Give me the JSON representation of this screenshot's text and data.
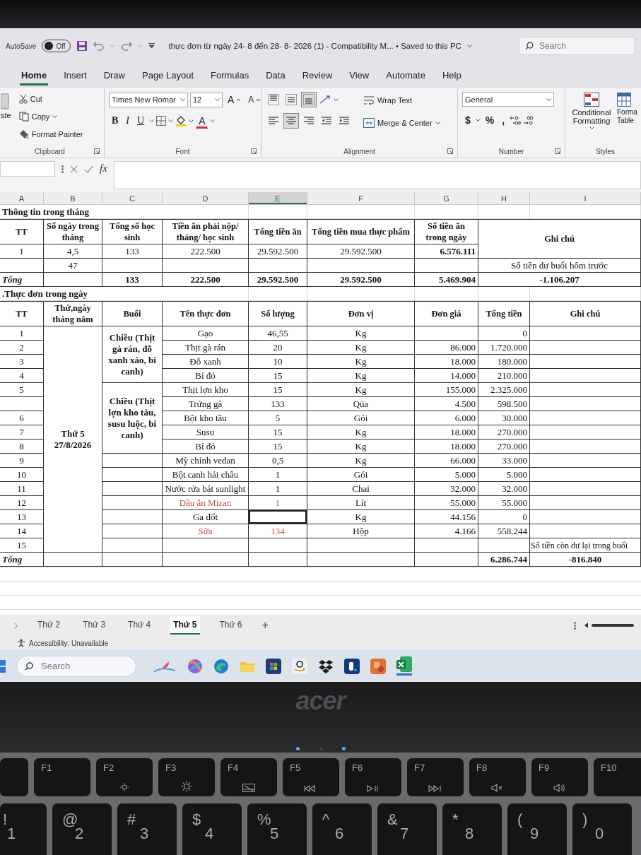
{
  "title_bar": {
    "autosave_label": "AutoSave",
    "autosave": {
      "on": false,
      "label": "Off"
    },
    "document_title": "thực đơn từ ngày 24- 8 đến 28- 8- 2026 (1) - Compatibility M... • Saved to this PC",
    "search": {
      "placeholder": "Search"
    }
  },
  "ribbon_tabs": [
    {
      "label": "Home",
      "selected": true
    },
    {
      "label": "Insert",
      "selected": false
    },
    {
      "label": "Draw",
      "selected": false
    },
    {
      "label": "Page Layout",
      "selected": false
    },
    {
      "label": "Formulas",
      "selected": false
    },
    {
      "label": "Data",
      "selected": false
    },
    {
      "label": "Review",
      "selected": false
    },
    {
      "label": "View",
      "selected": false
    },
    {
      "label": "Automate",
      "selected": false
    },
    {
      "label": "Help",
      "selected": false
    }
  ],
  "ribbon": {
    "clipboard": {
      "paste_label": "ste",
      "cut": "Cut",
      "copy": "Copy",
      "format_painter": "Format Painter",
      "group_label": "Clipboard"
    },
    "font": {
      "font_name": "Times New Romar",
      "font_size": "12",
      "grow_glyph": "A",
      "shrink_glyph": "A",
      "bold_glyph": "B",
      "italic_glyph": "I",
      "underline_glyph": "U",
      "font_color_glyph": "A",
      "group_label": "Font"
    },
    "alignment": {
      "buttons": [
        {
          "kind": "top",
          "selected": false
        },
        {
          "kind": "middle",
          "selected": false
        },
        {
          "kind": "bottom",
          "selected": true
        },
        {
          "kind": "left",
          "selected": false
        },
        {
          "kind": "center",
          "selected": true
        },
        {
          "kind": "right",
          "selected": false
        },
        {
          "kind": "indent-decrease",
          "selected": false
        },
        {
          "kind": "indent-increase",
          "selected": false
        }
      ],
      "wrap_text": "Wrap Text",
      "merge": "Merge & Center",
      "group_label": "Alignment"
    },
    "number": {
      "format": "General",
      "currency": "$",
      "percent": "%",
      "comma": ",",
      "group_label": "Number"
    },
    "styles": {
      "conditional": "Conditional Formatting",
      "format_table": "Forma Table",
      "group_label": "Styles"
    }
  },
  "formula_bar": {
    "fx": "fx"
  },
  "sheet": {
    "columns": [
      {
        "letter": "A",
        "selected": false
      },
      {
        "letter": "B",
        "selected": false
      },
      {
        "letter": "C",
        "selected": false
      },
      {
        "letter": "D",
        "selected": false
      },
      {
        "letter": "E",
        "selected": true
      },
      {
        "letter": "F",
        "selected": false
      },
      {
        "letter": "G",
        "selected": false
      },
      {
        "letter": "H",
        "selected": false
      },
      {
        "letter": "I",
        "selected": false
      }
    ],
    "info": {
      "title": "Thông tin trong tháng",
      "columns": [
        "TT",
        "Số ngày trong tháng",
        "Tổng số học sinh",
        "Tiền ăn phải nộp/ tháng/ học sinh",
        "Tổng tiền ăn",
        "Tổng tiền mua thực phẩm",
        "Số tiền ăn trong ngày",
        "Ghi chú"
      ],
      "rows": [
        {
          "kind": "data",
          "tt": "1",
          "days": "4,5",
          "students": "133",
          "fee": "222.500",
          "total_fee": "29.592.500",
          "food_total": "29.592.500",
          "daily": "6.576.111"
        },
        {
          "kind": "data",
          "days": "47",
          "note": "Số tiền dư buổi hôm trước"
        },
        {
          "kind": "total",
          "tt": "Tổng",
          "students": "133",
          "fee": "222.500",
          "total_fee": "29.592.500",
          "food_total": "29.592.500",
          "daily": "5.469.904",
          "note": "-1.106.207"
        }
      ]
    },
    "menu": {
      "title": ".Thực đơn trong ngày",
      "columns": [
        "TT",
        "Thứ,ngày tháng năm",
        "Buổi",
        "Tên thực đơn",
        "Số lượng",
        "Đơn vị",
        "Đơn giá",
        "Tổng tiền",
        "Ghi chú"
      ],
      "day": "Thứ 5 27/8/2026",
      "sessions": [
        {
          "label": "Chiều (Thịt gà rán, đỗ xanh xào, bí canh)",
          "items": [
            {
              "tt": "1",
              "name": "Gạo",
              "qty": "46,55",
              "unit": "Kg",
              "total": "0",
              "selected": false
            },
            {
              "tt": "2",
              "name": "Thịt gà rán",
              "qty": "20",
              "unit": "Kg",
              "price": "86.000",
              "total": "1.720.000",
              "selected": false
            },
            {
              "tt": "3",
              "name": "Đỗ xanh",
              "qty": "10",
              "unit": "Kg",
              "price": "18.000",
              "total": "180.000",
              "selected": false
            },
            {
              "tt": "4",
              "name": "Bí đỏ",
              "qty": "15",
              "unit": "Kg",
              "price": "14.000",
              "total": "210.000",
              "selected": false
            }
          ]
        },
        {
          "label": "Chiều (Thịt lợn kho tàu, susu luộc, bí canh)",
          "items": [
            {
              "tt": "5",
              "name": "Thịt lợn kho",
              "qty": "15",
              "unit": "Kg",
              "price": "155.000",
              "total": "2.325.000",
              "selected": false
            },
            {
              "name": "Trứng gà",
              "qty": "133",
              "unit": "Qủa",
              "price": "4.500",
              "total": "598.500",
              "selected": false
            },
            {
              "tt": "6",
              "name": "Bột kho tầu",
              "qty": "5",
              "unit": "Gói",
              "price": "6.000",
              "total": "30.000",
              "selected": false
            },
            {
              "tt": "7",
              "name": "Susu",
              "qty": "15",
              "unit": "Kg",
              "price": "18.000",
              "total": "270.000",
              "selected": false
            },
            {
              "tt": "8",
              "name": "Bí đỏ",
              "qty": "15",
              "unit": "Kg",
              "price": "18.000",
              "total": "270.000",
              "selected": false
            }
          ]
        },
        {
          "items": [
            {
              "tt": "9",
              "name": "Mỳ chính vedan",
              "qty": "0,5",
              "unit": "Kg",
              "price": "66.000",
              "total": "33.000",
              "selected": false
            },
            {
              "tt": "10",
              "name": "Bột canh hải châu",
              "qty": "1",
              "unit": "Gói",
              "price": "5.000",
              "total": "5.000",
              "selected": false
            },
            {
              "tt": "11",
              "name": "Nước rửa bát sunlight",
              "qty": "1",
              "unit": "Chai",
              "price": "32.000",
              "total": "32.000",
              "selected": false
            },
            {
              "tt": "12",
              "name": "Dầu ăn Mizan",
              "qty": "1",
              "unit": "Lít",
              "price": "55.000",
              "total": "55.000",
              "color": "#c0504d",
              "selected": false
            },
            {
              "tt": "13",
              "name": "Ga đốt",
              "unit": "Kg",
              "price": "44.156",
              "total": "0",
              "selected": true
            },
            {
              "tt": "14",
              "name": "Sữa",
              "qty": "134",
              "unit": "Hộp",
              "price": "4.166",
              "total": "558.244",
              "color": "#c0504d",
              "selected": false
            },
            {
              "tt": "15",
              "note": "Số tiền còn dư lại trong buổi",
              "selected": false
            }
          ]
        }
      ],
      "total": {
        "label": "Tổng",
        "total": "6.286.744",
        "note": "-816.840"
      }
    }
  },
  "sheet_tabs": {
    "tabs": [
      {
        "label": "Thứ 2",
        "selected": false
      },
      {
        "label": "Thứ 3",
        "selected": false
      },
      {
        "label": "Thứ 4",
        "selected": false
      },
      {
        "label": "Thứ 5",
        "selected": true
      },
      {
        "label": "Thứ 6",
        "selected": false
      }
    ],
    "add": "+"
  },
  "status_bar": {
    "accessibility": "Accessibility: Unavailable"
  },
  "taskbar": {
    "search": {
      "placeholder": "Search"
    }
  },
  "bezel": {
    "logo": "acer"
  },
  "keyboard": {
    "function_keys": [
      {
        "label": "F1",
        "kind": "plain"
      },
      {
        "label": "F2",
        "kind": "brightness-down"
      },
      {
        "label": "F3",
        "kind": "brightness-up"
      },
      {
        "label": "F4",
        "kind": "touchpad"
      },
      {
        "label": "F5",
        "kind": "previous"
      },
      {
        "label": "F6",
        "kind": "play-pause"
      },
      {
        "label": "F7",
        "kind": "next"
      },
      {
        "label": "F8",
        "kind": "mute"
      },
      {
        "label": "F9",
        "kind": "volume"
      },
      {
        "label": "F10",
        "kind": "plain"
      }
    ],
    "number_keys": [
      {
        "shift": "!",
        "main": "1"
      },
      {
        "shift": "@",
        "main": "2"
      },
      {
        "shift": "#",
        "main": "3"
      },
      {
        "shift": "$",
        "main": "4"
      },
      {
        "shift": "%",
        "main": "5"
      },
      {
        "shift": "^",
        "main": "6"
      },
      {
        "shift": "&",
        "main": "7"
      },
      {
        "shift": "*",
        "main": "8"
      },
      {
        "shift": "(",
        "main": "9"
      },
      {
        "shift": ")",
        "main": "0"
      }
    ]
  }
}
